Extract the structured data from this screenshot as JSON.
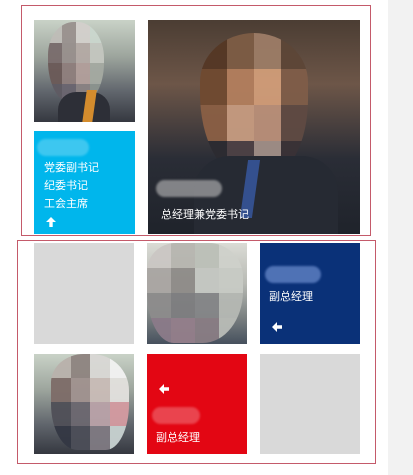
{
  "tiles": {
    "top_left_title_lines": [
      "党委副书记",
      "纪委书记",
      "工会主席"
    ],
    "top_right_title": "总经理兼党委书记",
    "bottom_navy_title": "副总经理",
    "bottom_red_title": "副总经理"
  },
  "colors": {
    "blue_tile": "#00b6ec",
    "navy_tile": "#0a3178",
    "red_tile": "#e30613",
    "gray_tile": "#d9d9d9",
    "group_border": "#c45a6a"
  },
  "icons": {
    "up_arrow": "arrow-up-icon",
    "left_arrow": "arrow-left-icon"
  }
}
